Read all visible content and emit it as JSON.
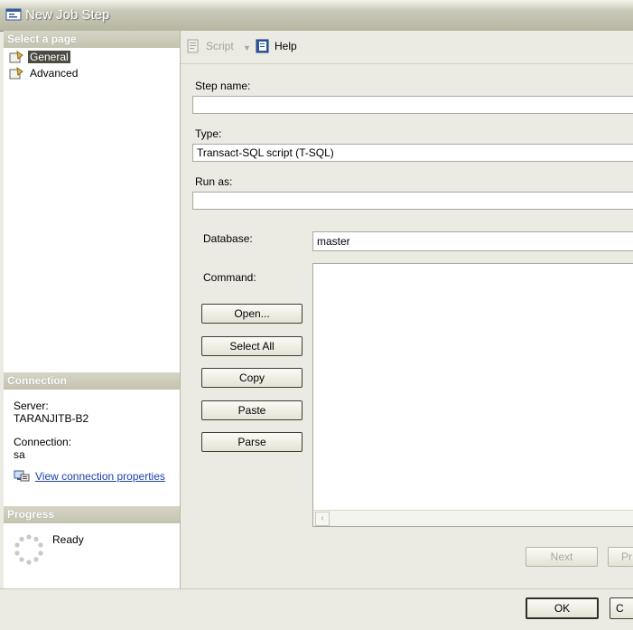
{
  "window": {
    "title": "New Job Step"
  },
  "left": {
    "select_page_header": "Select a page",
    "pages": [
      {
        "label": "General",
        "selected": true
      },
      {
        "label": "Advanced",
        "selected": false
      }
    ],
    "connection_header": "Connection",
    "server_label": "Server:",
    "server_value": "TARANJITB-B2",
    "connection_label": "Connection:",
    "connection_value": "sa",
    "view_connection_link": "View connection properties",
    "progress_header": "Progress",
    "progress_status": "Ready"
  },
  "toolbar": {
    "script_label": "Script",
    "help_label": "Help"
  },
  "form": {
    "step_name_label": "Step name:",
    "step_name_value": "",
    "type_label": "Type:",
    "type_value": "Transact-SQL script (T-SQL)",
    "run_as_label": "Run as:",
    "run_as_value": "",
    "database_label": "Database:",
    "database_value": "master",
    "command_label": "Command:",
    "buttons": {
      "open": "Open...",
      "select_all": "Select All",
      "copy": "Copy",
      "paste": "Paste",
      "parse": "Parse"
    },
    "next_label": "Next",
    "prev_label_fragment": "Pr"
  },
  "footer": {
    "ok_label": "OK",
    "cancel_label_fragment": "C"
  },
  "colors": {
    "panel_bg": "#ecebe3",
    "link": "#1c3fb0",
    "header_gradient": "#c4c3ae"
  }
}
